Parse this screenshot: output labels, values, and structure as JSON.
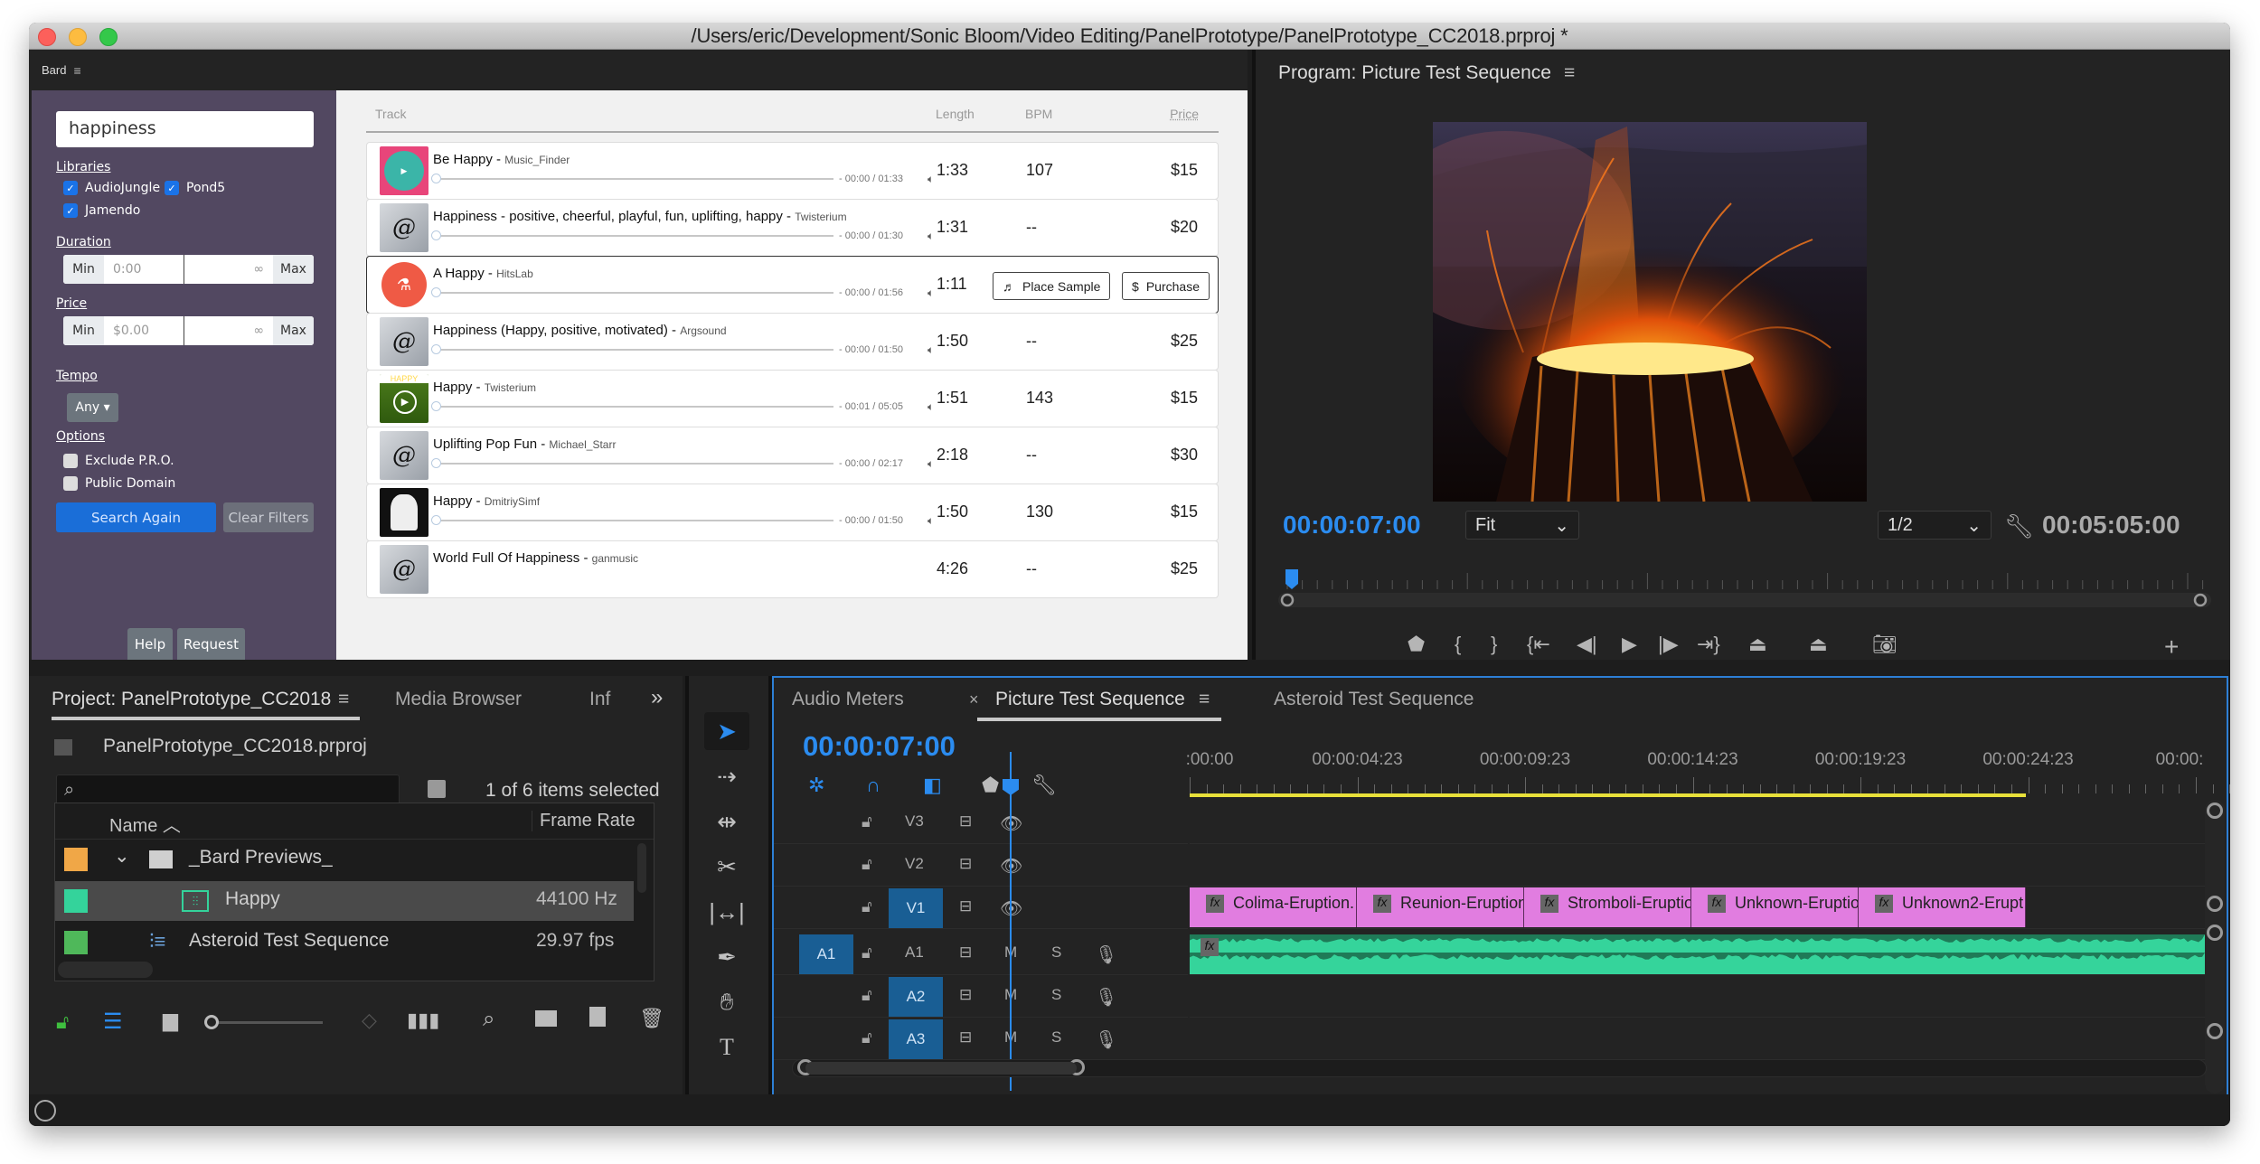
{
  "window": {
    "title": "/Users/eric/Development/Sonic Bloom/Video Editing/PanelPrototype/PanelPrototype_CC2018.prproj *"
  },
  "bard": {
    "panel_title": "Bard",
    "search_value": "happiness",
    "libraries_label": "Libraries",
    "libraries": [
      {
        "label": "AudioJungle",
        "checked": true
      },
      {
        "label": "Pond5",
        "checked": true
      },
      {
        "label": "Jamendo",
        "checked": true
      }
    ],
    "duration_label": "Duration",
    "duration": {
      "min_label": "Min",
      "min_placeholder": "0:00",
      "max_placeholder": "∞",
      "max_label": "Max"
    },
    "price_label": "Price",
    "price": {
      "min_label": "Min",
      "min_placeholder": "$0.00",
      "max_placeholder": "∞",
      "max_label": "Max"
    },
    "tempo_label": "Tempo",
    "tempo_value": "Any ▾",
    "options_label": "Options",
    "options": [
      {
        "label": "Exclude P.R.O.",
        "checked": false
      },
      {
        "label": "Public Domain",
        "checked": false
      }
    ],
    "search_again": "Search Again",
    "clear_filters": "Clear Filters",
    "help": "Help",
    "request": "Request",
    "columns": {
      "track": "Track",
      "length": "Length",
      "bpm": "BPM",
      "price": "Price"
    },
    "tracks": [
      {
        "title": "Be Happy",
        "artist": "Music_Finder",
        "time": "- 00:00 / 01:33",
        "length": "1:33",
        "bpm": "107",
        "price": "$15",
        "thumb": "music-finder"
      },
      {
        "title": "Happiness - positive, cheerful, playful, fun, uplifting, happy",
        "artist": "Twisterium",
        "time": "- 00:00 / 01:30",
        "length": "1:31",
        "bpm": "--",
        "price": "$20",
        "thumb": "default"
      },
      {
        "title": "A Happy",
        "artist": "HitsLab",
        "time": "- 00:00 / 01:56",
        "length": "1:11",
        "bpm": "",
        "price": "",
        "thumb": "hitslab",
        "selected": true,
        "place_sample": "Place Sample",
        "purchase": "Purchase"
      },
      {
        "title": "Happiness (Happy, positive, motivated)",
        "artist": "Argsound",
        "time": "- 00:00 / 01:50",
        "length": "1:50",
        "bpm": "--",
        "price": "$25",
        "thumb": "default"
      },
      {
        "title": "Happy",
        "artist": "Twisterium",
        "time": "- 00:01 / 05:05",
        "length": "1:51",
        "bpm": "143",
        "price": "$15",
        "thumb": "twisterium-happy"
      },
      {
        "title": "Uplifting Pop Fun",
        "artist": "Michael_Starr",
        "time": "- 00:00 / 02:17",
        "length": "2:18",
        "bpm": "--",
        "price": "$30",
        "thumb": "default"
      },
      {
        "title": "Happy",
        "artist": "DmitriySimf",
        "time": "- 00:00 / 01:50",
        "length": "1:50",
        "bpm": "130",
        "price": "$15",
        "thumb": "portrait"
      },
      {
        "title": "World Full Of Happiness",
        "artist": "ganmusic",
        "time": "",
        "length": "4:26",
        "bpm": "--",
        "price": "$25",
        "thumb": "default"
      }
    ]
  },
  "program": {
    "title": "Program: Picture Test Sequence",
    "current_tc": "00:00:07:00",
    "fit": "Fit",
    "resolution": "1/2",
    "duration_tc": "00:05:05:00"
  },
  "project": {
    "tabs": [
      "Project: PanelPrototype_CC2018",
      "Media Browser",
      "Inf"
    ],
    "file": "PanelPrototype_CC2018.prproj",
    "selection_status": "1 of 6 items selected",
    "columns": {
      "name": "Name",
      "frame_rate": "Frame Rate"
    },
    "items": [
      {
        "name": "_Bard Previews_",
        "rate": "",
        "color": "#f0a747",
        "type": "folder"
      },
      {
        "name": "Happy",
        "rate": "44100 Hz",
        "color": "#34d39b",
        "type": "audio",
        "selected": true
      },
      {
        "name": "Asteroid Test Sequence",
        "rate": "29.97 fps",
        "color": "#4fb85a",
        "type": "sequence"
      }
    ]
  },
  "timeline": {
    "tabs": [
      "Audio Meters",
      "Picture Test Sequence",
      "Asteroid Test Sequence"
    ],
    "current_tc": "00:00:07:00",
    "ruler_labels": [
      ":00:00",
      "00:00:04:23",
      "00:00:09:23",
      "00:00:14:23",
      "00:00:19:23",
      "00:00:24:23",
      "00:00:"
    ],
    "video_tracks": [
      "V3",
      "V2",
      "V1"
    ],
    "audio_tracks": [
      "A1",
      "A2",
      "A3"
    ],
    "source_patch": "A1",
    "mute_label": "M",
    "solo_label": "S",
    "clips": [
      "Colima-Eruption.",
      "Reunion-Eruption",
      "Stromboli-Eruptio",
      "Unknown-Eruptio",
      "Unknown2-Erupt"
    ],
    "clip_color": "#e17de0",
    "audio_clip_color": "#35d49b",
    "accent": "#2b8cf0"
  }
}
